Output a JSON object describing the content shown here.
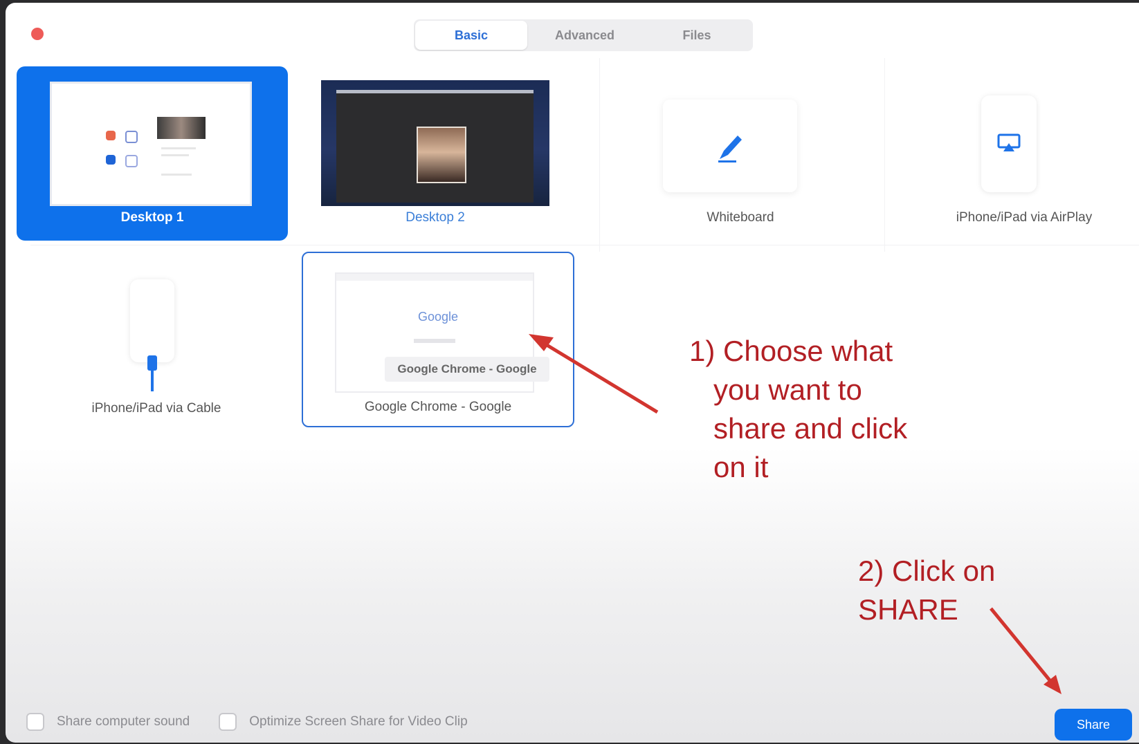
{
  "tabs": [
    {
      "label": "Basic",
      "active": true
    },
    {
      "label": "Advanced",
      "active": false
    },
    {
      "label": "Files",
      "active": false
    }
  ],
  "options": [
    {
      "label": "Desktop 1",
      "icon": "desktop-thumbnail",
      "state": "selected"
    },
    {
      "label": "Desktop 2",
      "icon": "desktop-thumbnail",
      "state": "normal"
    },
    {
      "label": "Whiteboard",
      "icon": "pen-icon",
      "state": "normal"
    },
    {
      "label": "iPhone/iPad via AirPlay",
      "icon": "airplay-icon",
      "state": "normal"
    },
    {
      "label": "iPhone/iPad via Cable",
      "icon": "cable-icon",
      "state": "normal"
    },
    {
      "label": "Google Chrome - Google",
      "icon": "chrome-window-thumbnail",
      "state": "hover"
    }
  ],
  "chrome_preview": {
    "logo_text": "Google",
    "tooltip": "Google Chrome - Google"
  },
  "annotations": {
    "step1": "1) Choose what\n   you want to\n   share and click\n   on it",
    "step2": "2) Click on\nSHARE"
  },
  "footer": {
    "share_sound_label": "Share computer sound",
    "optimize_label": "Optimize Screen Share for Video Clip",
    "share_sound_checked": false,
    "optimize_checked": false
  },
  "share_button": "Share",
  "colors": {
    "accent": "#0e71eb",
    "annotation": "#b21f24",
    "close_button": "#ee5b58"
  }
}
